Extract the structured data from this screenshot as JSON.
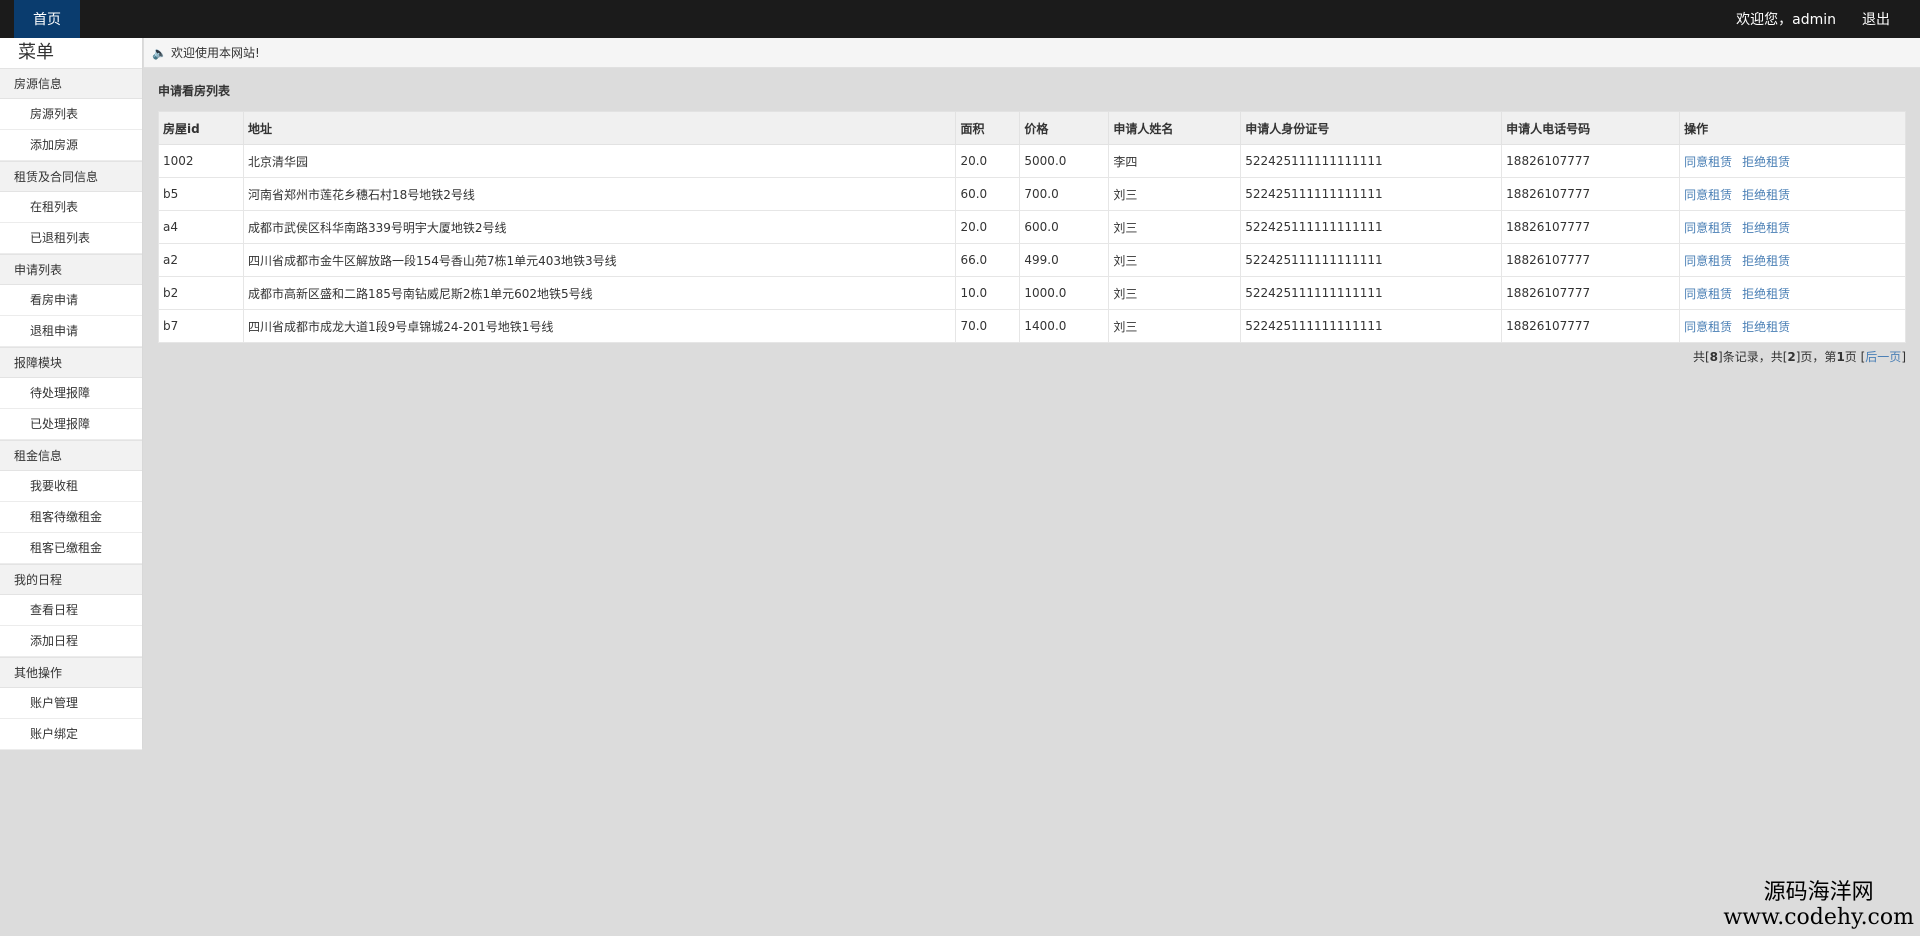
{
  "topbar": {
    "home_tab": "首页",
    "welcome": "欢迎您，admin",
    "logout": "退出"
  },
  "sidebar": {
    "title": "菜单",
    "groups": [
      {
        "label": "房源信息",
        "items": [
          "房源列表",
          "添加房源"
        ]
      },
      {
        "label": "租赁及合同信息",
        "items": [
          "在租列表",
          "已退租列表"
        ]
      },
      {
        "label": "申请列表",
        "items": [
          "看房申请",
          "退租申请"
        ]
      },
      {
        "label": "报障模块",
        "items": [
          "待处理报障",
          "已处理报障"
        ]
      },
      {
        "label": "租金信息",
        "items": [
          "我要收租",
          "租客待缴租金",
          "租客已缴租金"
        ]
      },
      {
        "label": "我的日程",
        "items": [
          "查看日程",
          "添加日程"
        ]
      },
      {
        "label": "其他操作",
        "items": [
          "账户管理",
          "账户绑定"
        ]
      }
    ]
  },
  "notice": "欢迎使用本网站!",
  "main": {
    "section_title": "申请看房列表",
    "columns": [
      "房屋id",
      "地址",
      "面积",
      "价格",
      "申请人姓名",
      "申请人身份证号",
      "申请人电话号码",
      "操作"
    ],
    "rows": [
      [
        "1002",
        "北京清华园",
        "20.0",
        "5000.0",
        "李四",
        "522425111111111111",
        "18826107777"
      ],
      [
        "b5",
        "河南省郑州市莲花乡穗石村18号地铁2号线",
        "60.0",
        "700.0",
        "刘三",
        "522425111111111111",
        "18826107777"
      ],
      [
        "a4",
        "成都市武侯区科华南路339号明宇大厦地铁2号线",
        "20.0",
        "600.0",
        "刘三",
        "522425111111111111",
        "18826107777"
      ],
      [
        "a2",
        "四川省成都市金牛区解放路一段154号香山苑7栋1单元403地铁3号线",
        "66.0",
        "499.0",
        "刘三",
        "522425111111111111",
        "18826107777"
      ],
      [
        "b2",
        "成都市高新区盛和二路185号南钻威尼斯2栋1单元602地铁5号线",
        "10.0",
        "1000.0",
        "刘三",
        "522425111111111111",
        "18826107777"
      ],
      [
        "b7",
        "四川省成都市成龙大道1段9号卓锦城24-201号地铁1号线",
        "70.0",
        "1400.0",
        "刘三",
        "522425111111111111",
        "18826107777"
      ]
    ],
    "actions": {
      "agree": "同意租赁",
      "reject": "拒绝租赁"
    },
    "pager": {
      "prefix": "共[",
      "total_records": "8",
      "mid1": "]条记录，共[",
      "total_pages": "2",
      "mid2": "]页，第",
      "current_page": "1",
      "mid3": "页 [",
      "next": "后一页",
      "suffix": "]"
    }
  },
  "watermark": {
    "cn": "源码海洋网",
    "url": "www.codehy.com"
  }
}
